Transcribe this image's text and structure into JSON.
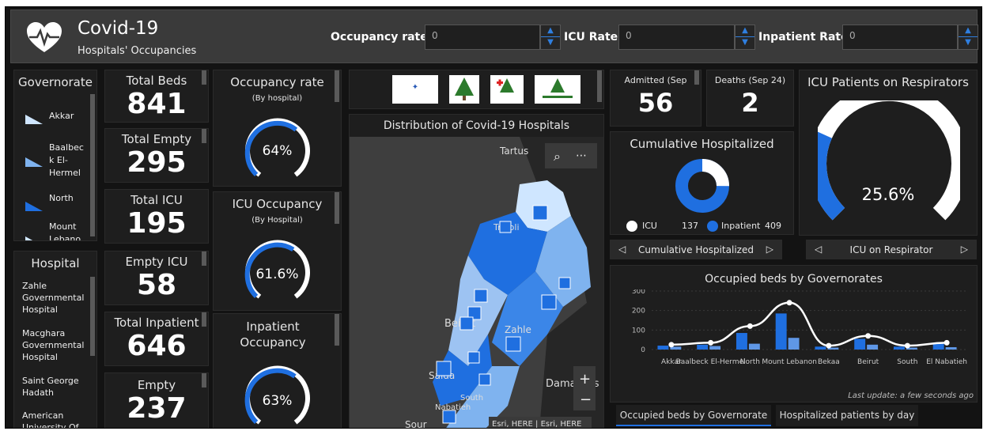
{
  "header": {
    "title": "Covid-19",
    "subtitle": "Hospitals' Occupancies",
    "filters": [
      {
        "label": "Occupancy rate >",
        "value": "0"
      },
      {
        "label": "ICU Rate >",
        "value": "0"
      },
      {
        "label": "Inpatient Rate >",
        "value": "0"
      }
    ]
  },
  "governorates": {
    "title": "Governorate",
    "items": [
      {
        "label": "Akkar",
        "color": "#cfe6ff"
      },
      {
        "label": "Baalbec k El-Hermel",
        "color": "#7fb3ef"
      },
      {
        "label": "North",
        "color": "#1f6fe0"
      },
      {
        "label": "Mount Lebano",
        "color": "#cfe6ff"
      }
    ]
  },
  "hospitals": {
    "title": "Hospital",
    "items": [
      "Zahle Governmental Hospital",
      "Macghara Governmental Hospital",
      "Saint George Hadath",
      "American University Of"
    ]
  },
  "stats": {
    "total_beds": {
      "label": "Total Beds",
      "value": "841"
    },
    "total_empty": {
      "label": "Total Empty",
      "value": "295"
    },
    "total_icu": {
      "label": "Total ICU",
      "value": "195"
    },
    "empty_icu": {
      "label": "Empty ICU",
      "value": "58"
    },
    "total_inpatient": {
      "label": "Total Inpatient",
      "value": "646"
    },
    "empty": {
      "label": "Empty",
      "value": "237"
    }
  },
  "gauges": {
    "occupancy": {
      "title": "Occupancy rate",
      "sub": "(By hospital)",
      "value": "64%",
      "fraction": 0.64
    },
    "icu": {
      "title": "ICU Occupancy",
      "sub": "(By Hospital)",
      "value": "61.6%",
      "fraction": 0.616
    },
    "inpatient": {
      "title": "Inpatient Occupancy",
      "value": "63%",
      "fraction": 0.63
    }
  },
  "map": {
    "title": "Distribution of Covid-19 Hospitals",
    "labels": [
      "Tartus",
      "Tripoli",
      "Beirut",
      "Zahle",
      "Saida",
      "Sour",
      "Damascus",
      "South",
      "Nabatieh"
    ],
    "attribution": "Esri, HERE | Esri, HERE",
    "marker": "H"
  },
  "kpis": {
    "admitted": {
      "label": "Admitted (Sep",
      "value": "56"
    },
    "deaths": {
      "label": "Deaths (Sep 24)",
      "value": "2"
    }
  },
  "cumulative": {
    "title": "Cumulative Hospitalized",
    "legend": [
      {
        "label": "ICU",
        "value": "137",
        "color": "#ffffff"
      },
      {
        "label": "Inpatient",
        "value": "409",
        "color": "#1f6fe0"
      }
    ],
    "nav_label": "Cumulative Hospitalized"
  },
  "icu_resp": {
    "title": "ICU Patients on Respirators",
    "value": "25.6%",
    "fraction": 0.256,
    "nav_label": "ICU on Respirator"
  },
  "chart_data": {
    "type": "bar",
    "title": "Occupied beds by Governorates",
    "categories": [
      "Akkar",
      "Baalbeck El-Hermel",
      "North",
      "Mount Lebanon",
      "Bekaa",
      "Beirut",
      "South",
      "El Nabatieh"
    ],
    "series": [
      {
        "color": "#1f6fe0",
        "values": [
          20,
          25,
          85,
          185,
          15,
          55,
          15,
          30
        ]
      },
      {
        "color": "#5f97e6",
        "values": [
          15,
          18,
          30,
          60,
          10,
          25,
          10,
          12
        ]
      }
    ],
    "line": [
      25,
      35,
      120,
      240,
      20,
      70,
      20,
      35
    ],
    "ylim": [
      0,
      300
    ],
    "yticks": [
      "300",
      "200",
      "100",
      "0"
    ],
    "footer": "Last update: a few seconds ago"
  },
  "tabs": [
    "Occupied beds by Governorate",
    "Hospitalized patients by day"
  ],
  "colors": {
    "accent": "#1f6fe0",
    "panel": "#1e1e1e"
  }
}
